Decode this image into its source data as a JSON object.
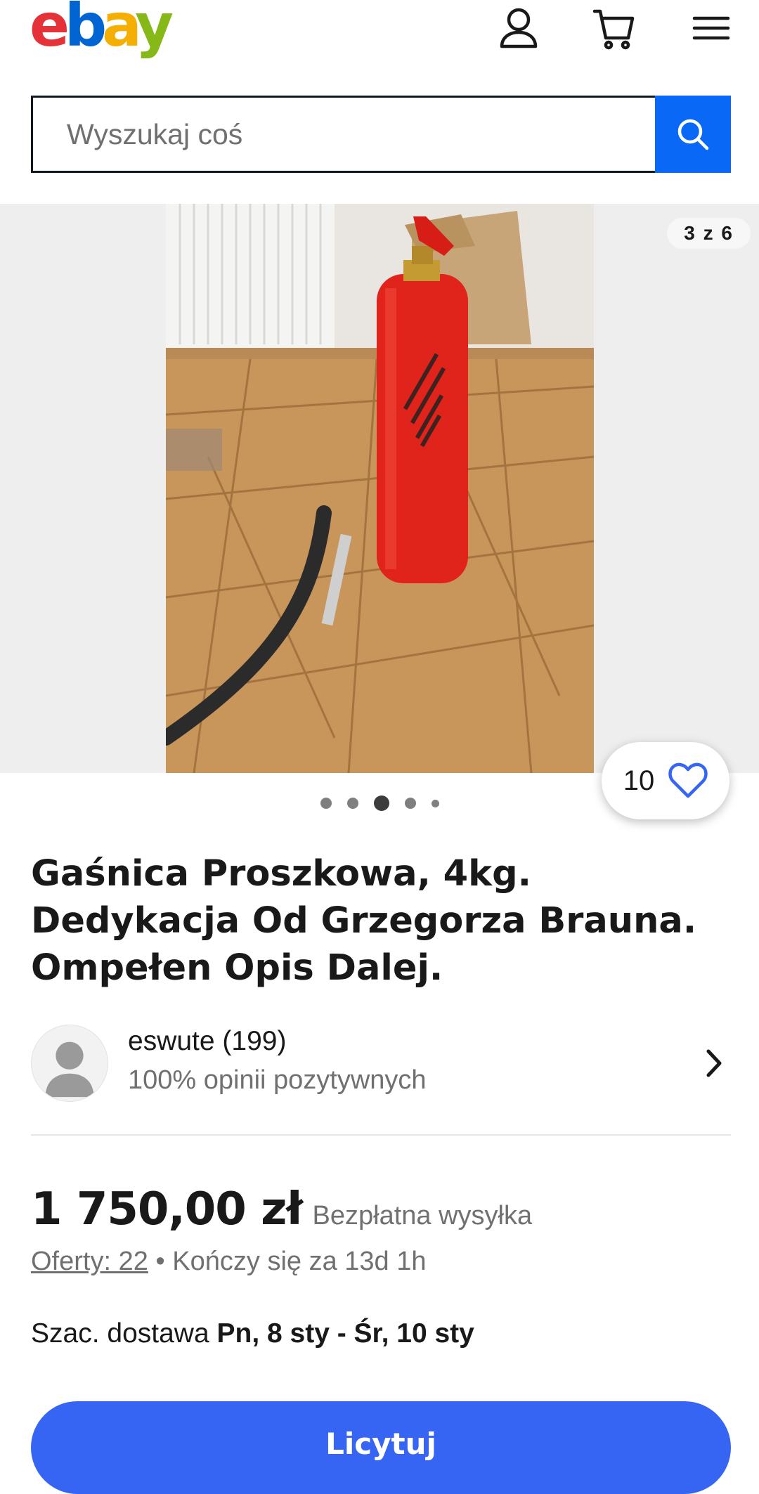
{
  "header": {
    "logo": [
      "e",
      "b",
      "a",
      "y"
    ],
    "icons": [
      "user-icon",
      "cart-icon",
      "menu-icon"
    ]
  },
  "search": {
    "placeholder": "Wyszukaj coś",
    "button_icon": "search-icon"
  },
  "gallery": {
    "counter": "3 z 6",
    "dots": 5,
    "active_dot": 3
  },
  "watch": {
    "count": "10",
    "icon": "heart-icon"
  },
  "item": {
    "title": "Gaśnica Proszkowa, 4kg. Dedykacja Od Grzegorza Brauna. Ompełen Opis Dalej."
  },
  "seller": {
    "name": "eswute (199)",
    "feedback": "100% opinii pozytywnych"
  },
  "price": {
    "amount": "1 750,00 zł",
    "shipping": "Bezpłatna wysyłka"
  },
  "bids": {
    "label": "Oferty: 22",
    "separator": "•",
    "ends": "Kończy się za 13d 1h"
  },
  "delivery": {
    "prefix": "Szac. dostawa",
    "dates": "Pn, 8 sty - Śr, 10 sty"
  },
  "cta": {
    "label": "Licytuj"
  },
  "colors": {
    "primary_blue": "#3665f3",
    "search_blue": "#0968f6",
    "ebay_red": "#e53238",
    "ebay_blue": "#0064d2",
    "ebay_yellow": "#f5af02",
    "ebay_green": "#86b817"
  }
}
